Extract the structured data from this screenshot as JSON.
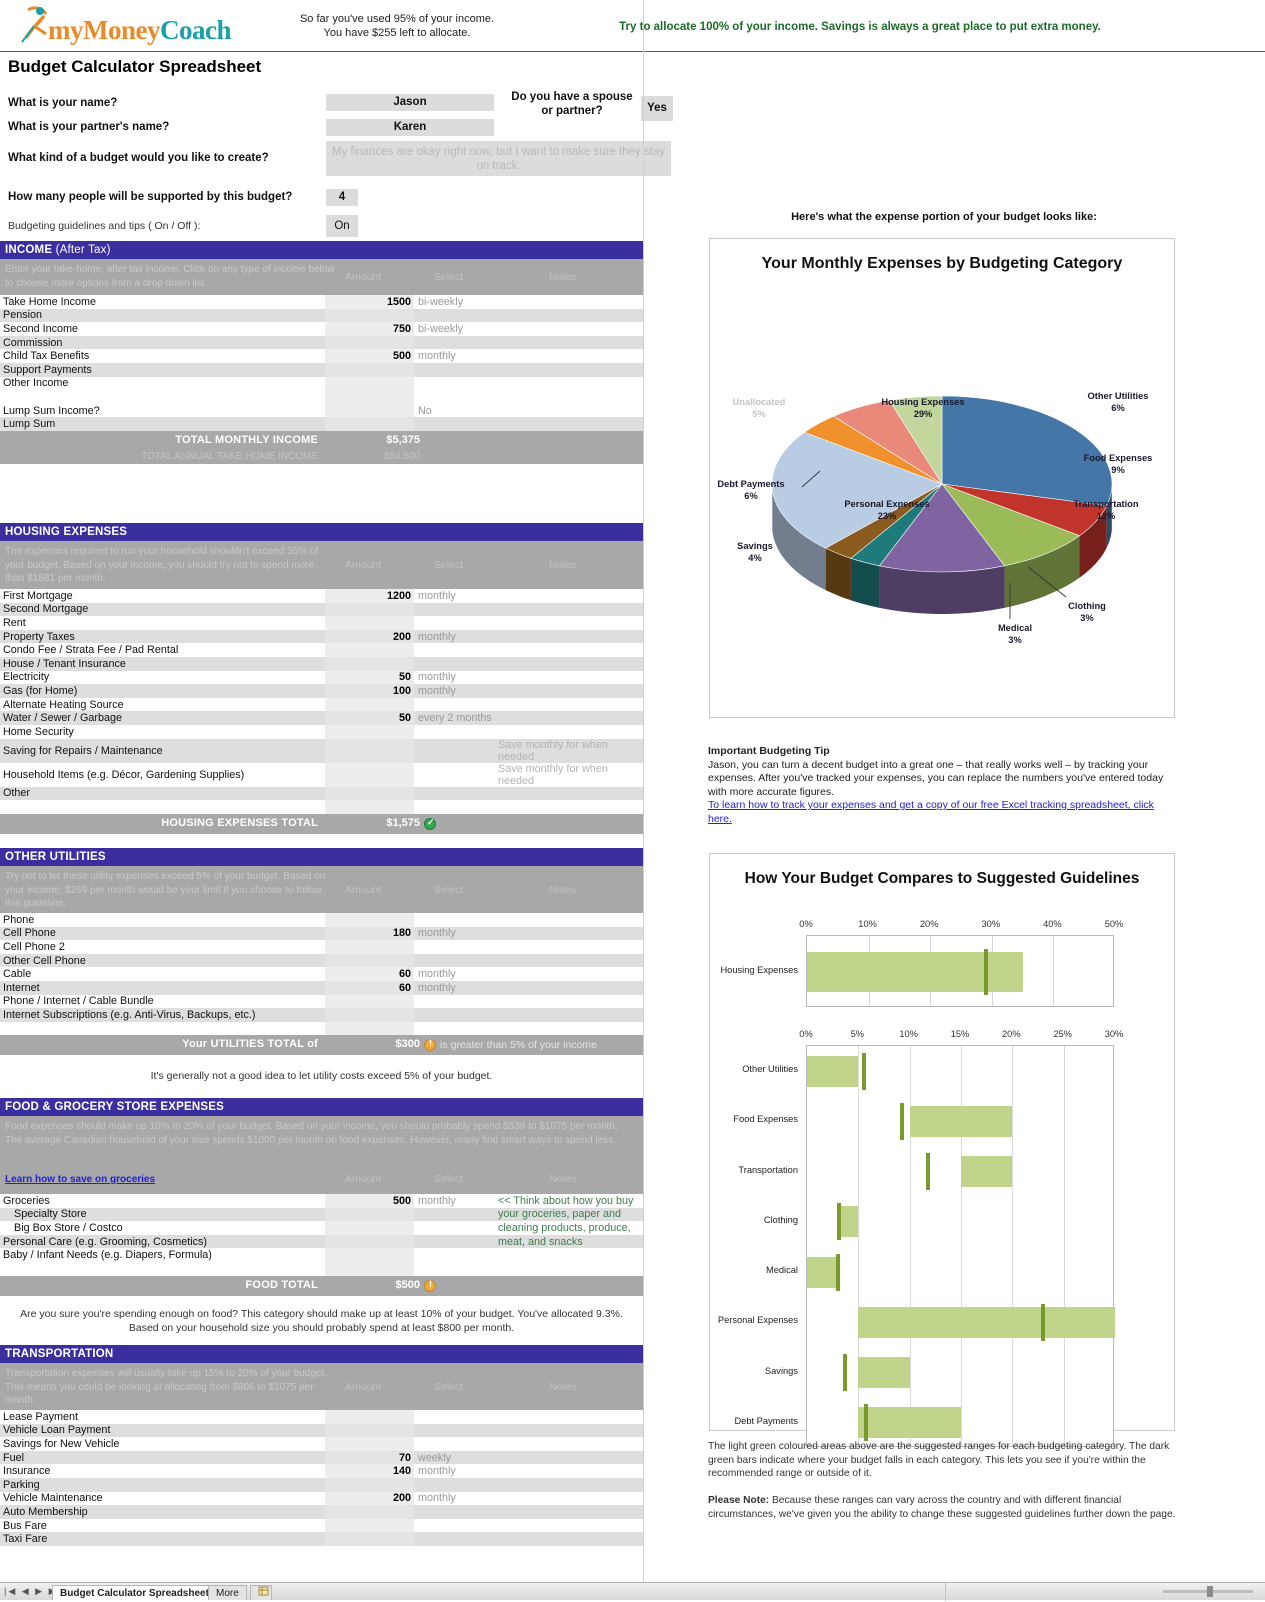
{
  "brand": {
    "part1": "my",
    "part2": "Money",
    "part3": "Coach"
  },
  "header": {
    "usage_line1": "So far you've used 95% of your income.",
    "usage_line2": "You have $255 left to allocate.",
    "tip": "Try to allocate 100% of your income. Savings is always a great place to put extra money.",
    "page_title": "Budget Calculator Spreadsheet"
  },
  "questions": [
    {
      "label": "What is your name?",
      "value": "Jason"
    },
    {
      "label": "What is your partner's name?",
      "value": "Karen"
    },
    {
      "label": "What kind of a budget would you like to create?",
      "value": "My finances are okay right now, but I want to make sure they stay on track."
    },
    {
      "label": "How many people will be supported by this budget?",
      "value": "4"
    },
    {
      "label": "Budgeting guidelines and tips ( On / Off ):",
      "value": "On"
    }
  ],
  "spouse": {
    "label": "Do you have a spouse or partner?",
    "value": "Yes"
  },
  "columns": {
    "amount": "Amount",
    "select": "Select",
    "notes": "Notes"
  },
  "income": {
    "title": "INCOME",
    "subtitle": "(After Tax)",
    "desc": "Enter your take-home, after tax income. Click on any type of income below to choose more options from a drop down list",
    "rows": [
      {
        "name": "Take Home Income",
        "amount": "1500",
        "select": "bi-weekly",
        "note": ""
      },
      {
        "name": "Pension",
        "amount": "",
        "select": "",
        "note": ""
      },
      {
        "name": "Second Income",
        "amount": "750",
        "select": "bi-weekly",
        "note": ""
      },
      {
        "name": "Commission",
        "amount": "",
        "select": "",
        "note": ""
      },
      {
        "name": "Child Tax Benefits",
        "amount": "500",
        "select": "monthly",
        "note": ""
      },
      {
        "name": "Support Payments",
        "amount": "",
        "select": "",
        "note": ""
      },
      {
        "name": "Other Income",
        "amount": "",
        "select": "",
        "note": ""
      },
      {
        "name": "",
        "amount": "",
        "select": "",
        "note": ""
      },
      {
        "name": "Lump Sum Income?",
        "amount": "",
        "select": "No",
        "note": ""
      },
      {
        "name": "Lump Sum",
        "amount": "",
        "select": "",
        "note": ""
      }
    ],
    "total_label": "TOTAL MONTHLY INCOME",
    "total_value": "$5,375",
    "annual_label": "TOTAL ANNUAL TAKE HOME INCOME",
    "annual_value": "$64,500"
  },
  "housing": {
    "title": "HOUSING EXPENSES",
    "desc": "The expenses required to run your household shouldn't exceed 35% of your budget. Based on your income, you should try not to spend more than $1881 per month.",
    "rows": [
      {
        "name": "First Mortgage",
        "amount": "1200",
        "select": "monthly",
        "note": ""
      },
      {
        "name": "Second Mortgage",
        "amount": "",
        "select": "",
        "note": ""
      },
      {
        "name": "Rent",
        "amount": "",
        "select": "",
        "note": ""
      },
      {
        "name": "Property Taxes",
        "amount": "200",
        "select": "monthly",
        "note": ""
      },
      {
        "name": "Condo Fee / Strata Fee / Pad Rental",
        "amount": "",
        "select": "",
        "note": ""
      },
      {
        "name": "House / Tenant Insurance",
        "amount": "",
        "select": "",
        "note": ""
      },
      {
        "name": "Electricity",
        "amount": "50",
        "select": "monthly",
        "note": ""
      },
      {
        "name": "Gas (for Home)",
        "amount": "100",
        "select": "monthly",
        "note": ""
      },
      {
        "name": "Alternate Heating Source",
        "amount": "",
        "select": "",
        "note": ""
      },
      {
        "name": "Water / Sewer / Garbage",
        "amount": "50",
        "select": "every 2 months",
        "note": ""
      },
      {
        "name": "Home Security",
        "amount": "",
        "select": "",
        "note": ""
      },
      {
        "name": "Saving for Repairs / Maintenance",
        "amount": "",
        "select": "",
        "note": "Save monthly for when needed"
      },
      {
        "name": "Household Items (e.g. Décor, Gardening Supplies)",
        "amount": "",
        "select": "",
        "note": "Save monthly for when needed"
      },
      {
        "name": "Other",
        "amount": "",
        "select": "",
        "note": ""
      },
      {
        "name": "",
        "amount": "",
        "select": "",
        "note": ""
      }
    ],
    "total_label": "HOUSING EXPENSES TOTAL",
    "total_value": "$1,575",
    "status": "ok"
  },
  "utilities": {
    "title": "OTHER UTILITIES",
    "desc": "Try not to let these utility expenses exceed 5% of your budget. Based on your income, $269 per month would be your limit if you choose to follow this guideline.",
    "rows": [
      {
        "name": "Phone",
        "amount": "",
        "select": "",
        "note": ""
      },
      {
        "name": "Cell Phone",
        "amount": "180",
        "select": "monthly",
        "note": ""
      },
      {
        "name": "Cell Phone 2",
        "amount": "",
        "select": "",
        "note": ""
      },
      {
        "name": "Other Cell Phone",
        "amount": "",
        "select": "",
        "note": ""
      },
      {
        "name": "Cable",
        "amount": "60",
        "select": "monthly",
        "note": ""
      },
      {
        "name": "Internet",
        "amount": "60",
        "select": "monthly",
        "note": ""
      },
      {
        "name": "Phone / Internet / Cable Bundle",
        "amount": "",
        "select": "",
        "note": ""
      },
      {
        "name": "Internet Subscriptions (e.g. Anti-Virus, Backups, etc.)",
        "amount": "",
        "select": "",
        "note": ""
      },
      {
        "name": "",
        "amount": "",
        "select": "",
        "note": ""
      }
    ],
    "total_label": "Your UTILITIES TOTAL of",
    "total_value": "$300",
    "total_after": "is greater than 5% of your income",
    "status": "warn",
    "footer": "It's generally not a good idea to let utility costs exceed 5% of your budget."
  },
  "food": {
    "title": "FOOD & GROCERY STORE EXPENSES",
    "desc": "Food expenses should make up 10% to 20% of your budget. Based on your income, you should probably spend $538 to $1075 per month. The average Canadian household of your size spends $1000 per month on food expenses. However, many find smart ways to spend less.",
    "link": "Learn how to save on groceries",
    "rows": [
      {
        "name": "Groceries",
        "amount": "500",
        "select": "monthly",
        "note": "<< Think about how you buy",
        "indent": false,
        "green": true
      },
      {
        "name": "Specialty Store",
        "amount": "",
        "select": "",
        "note": "your groceries, paper and",
        "indent": true,
        "green": true
      },
      {
        "name": "Big Box Store / Costco",
        "amount": "",
        "select": "",
        "note": "cleaning products, produce,",
        "indent": true,
        "green": true
      },
      {
        "name": "Personal Care (e.g. Grooming, Cosmetics)",
        "amount": "",
        "select": "",
        "note": "meat, and snacks",
        "indent": false,
        "green": true
      },
      {
        "name": "Baby / Infant Needs (e.g. Diapers, Formula)",
        "amount": "",
        "select": "",
        "note": "",
        "indent": false,
        "green": false
      },
      {
        "name": "",
        "amount": "",
        "select": "",
        "note": "",
        "indent": false,
        "green": false
      }
    ],
    "total_label": "FOOD TOTAL",
    "total_value": "$500",
    "status": "warn",
    "footer1": "Are you sure you're spending enough on food? This category should make up at least 10% of your budget. You've allocated 9.3%.",
    "footer2": "Based on your household size you should probably spend at least $800 per month."
  },
  "transportation": {
    "title": "TRANSPORTATION",
    "desc": "Transportation expenses will usually take up 15% to 20% of your budget. This means you could be looking at allocating from $806 to $1075 per month.",
    "rows": [
      {
        "name": "Lease Payment",
        "amount": "",
        "select": "",
        "note": ""
      },
      {
        "name": "Vehicle Loan Payment",
        "amount": "",
        "select": "",
        "note": ""
      },
      {
        "name": "Savings for New Vehicle",
        "amount": "",
        "select": "",
        "note": ""
      },
      {
        "name": "Fuel",
        "amount": "70",
        "select": "weekly",
        "note": ""
      },
      {
        "name": "Insurance",
        "amount": "140",
        "select": "monthly",
        "note": ""
      },
      {
        "name": "Parking",
        "amount": "",
        "select": "",
        "note": ""
      },
      {
        "name": "Vehicle Maintenance",
        "amount": "200",
        "select": "monthly",
        "note": ""
      },
      {
        "name": "Auto Membership",
        "amount": "",
        "select": "",
        "note": ""
      },
      {
        "name": "Bus Fare",
        "amount": "",
        "select": "",
        "note": ""
      },
      {
        "name": "Taxi Fare",
        "amount": "",
        "select": "",
        "note": ""
      }
    ]
  },
  "right": {
    "chart_caption": "Here's what the expense portion of your budget looks like:",
    "tip_heading": "Important Budgeting Tip",
    "tip_body": "Jason, you can turn a decent budget into a great one – that really works well – by tracking your expenses. After you've tracked your expenses, you can replace the numbers you've entered today with more accurate figures.",
    "tip_link": "To learn how to track your expenses and get a copy of our free Excel tracking spreadsheet, click here.",
    "note1": "The light green coloured areas above are the suggested ranges for each budgeting category. The dark green bars indicate where your budget falls in each category. This lets you see if you're within the recommended range or outside of it.",
    "note2_bold": "Please Note:",
    "note2": " Because these ranges can vary across the country and with different financial circumstances, we've given you the ability to change these suggested guidelines further down the page."
  },
  "statusbar": {
    "tab1": "Budget Calculator Spreadsheet",
    "tab2": "More"
  },
  "chart_data": [
    {
      "type": "pie",
      "title": "Your Monthly Expenses by Budgeting Category",
      "labels": [
        "Housing Expenses",
        "Other Utilities",
        "Food Expenses",
        "Transportation",
        "Clothing",
        "Medical",
        "Personal Expenses",
        "Savings",
        "Debt Payments",
        "Unallocated"
      ],
      "values": [
        29,
        6,
        9,
        12,
        3,
        3,
        23,
        4,
        6,
        5
      ],
      "value_labels": [
        "29%",
        "6%",
        "9%",
        "12%",
        "3%",
        "3%",
        "23%",
        "4%",
        "6%",
        "5%"
      ],
      "colors": [
        "#4576a8",
        "#c0342c",
        "#9bbb59",
        "#8064a2",
        "#1f7a7a",
        "#8a5a1e",
        "#b8cce4",
        "#f0912d",
        "#e8897a",
        "#c3d69b"
      ],
      "legend": "none"
    },
    {
      "type": "bar",
      "title": "How Your Budget Compares to Suggested Guidelines",
      "subcharts": [
        {
          "axis_ticks": [
            "0%",
            "10%",
            "20%",
            "30%",
            "40%",
            "50%"
          ],
          "axis_max": 50,
          "categories": [
            "Housing Expenses"
          ],
          "ranges": [
            [
              0,
              35
            ]
          ],
          "actuals": [
            29
          ]
        },
        {
          "axis_ticks": [
            "0%",
            "5%",
            "10%",
            "15%",
            "20%",
            "25%",
            "30%"
          ],
          "axis_max": 30,
          "categories": [
            "Other Utilities",
            "Food Expenses",
            "Transportation",
            "Clothing",
            "Medical",
            "Personal Expenses",
            "Savings",
            "Debt Payments"
          ],
          "ranges": [
            [
              0,
              5
            ],
            [
              10,
              20
            ],
            [
              15,
              20
            ],
            [
              3,
              5
            ],
            [
              0,
              3
            ],
            [
              5,
              30
            ],
            [
              5,
              10
            ],
            [
              5,
              15
            ]
          ],
          "actuals": [
            5.6,
            9.3,
            11.8,
            3.1,
            3.0,
            23.0,
            3.7,
            5.7
          ]
        }
      ],
      "range_color": "#c0d48b",
      "marker_color": "#7a9a2e"
    }
  ]
}
